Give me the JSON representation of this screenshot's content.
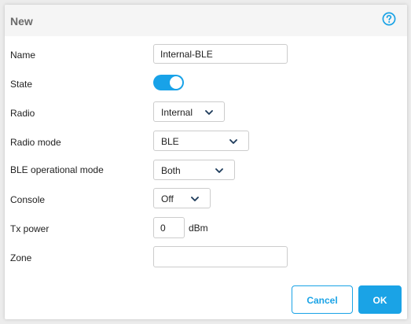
{
  "dialog": {
    "title": "New",
    "help_icon": "question-circle-icon",
    "accent_color": "#1aa3e6"
  },
  "form": {
    "name": {
      "label": "Name",
      "value": "Internal-BLE",
      "placeholder": ""
    },
    "state": {
      "label": "State",
      "enabled": true
    },
    "radio": {
      "label": "Radio",
      "value": "Internal"
    },
    "radio_mode": {
      "label": "Radio mode",
      "value": "BLE"
    },
    "ble_operational_mode": {
      "label": "BLE operational mode",
      "value": "Both"
    },
    "console": {
      "label": "Console",
      "value": "Off"
    },
    "tx_power": {
      "label": "Tx power",
      "value": "0",
      "unit": "dBm"
    },
    "zone": {
      "label": "Zone",
      "value": "",
      "placeholder": ""
    }
  },
  "actions": {
    "cancel_label": "Cancel",
    "ok_label": "OK"
  },
  "icons": {
    "dropdown": "chevron-down-icon"
  }
}
